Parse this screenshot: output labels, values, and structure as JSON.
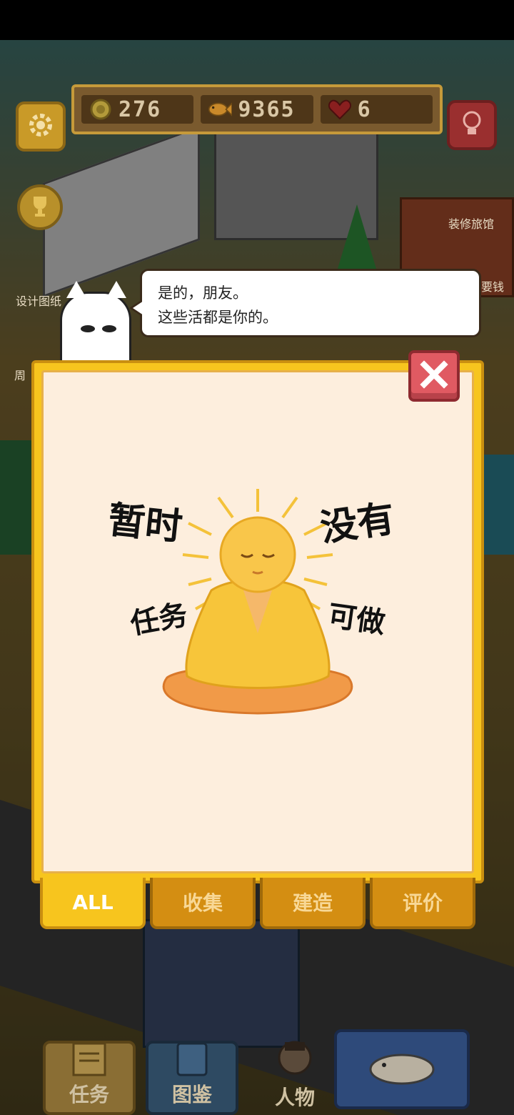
{
  "resources": {
    "coins": "276",
    "fish": "9365",
    "hearts": "6"
  },
  "background_labels": {
    "decorate": "装修旅馆",
    "design": "设计图纸",
    "money": "要钱",
    "week": "周"
  },
  "dialog": {
    "line1": "是的，朋友。",
    "line2": "这些活都是你的。"
  },
  "empty_state": {
    "word1": "暂时",
    "word2": "没有",
    "word3": "任务",
    "word4": "可做"
  },
  "tabs": [
    {
      "label": "ALL",
      "active": true
    },
    {
      "label": "收集",
      "active": false
    },
    {
      "label": "建造",
      "active": false
    },
    {
      "label": "评价",
      "active": false
    }
  ],
  "bottom_nav": [
    {
      "label": "任务"
    },
    {
      "label": "图鉴"
    },
    {
      "label": "人物"
    }
  ],
  "colors": {
    "panel": "#f7c51e",
    "panel_inner": "#fdeedd",
    "close": "#e05a62",
    "tab_inactive": "#d48e12"
  }
}
